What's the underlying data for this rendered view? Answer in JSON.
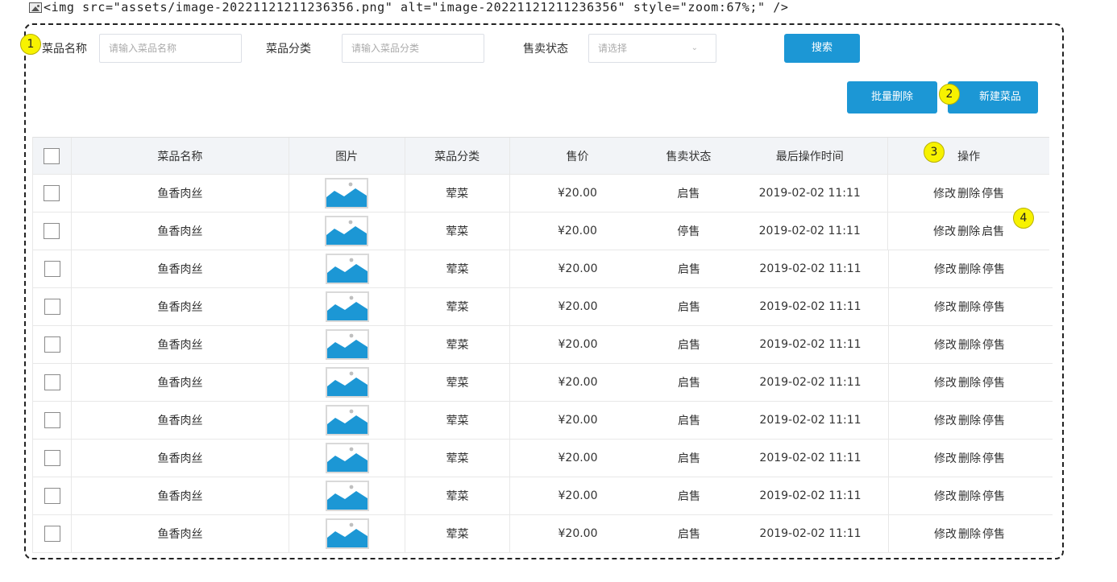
{
  "top_line": {
    "text": "<img src=\"assets/image-20221121211236356.png\" alt=\"image-20221121211236356\" style=\"zoom:67%;\" />"
  },
  "filters": {
    "name_label": "菜品名称",
    "name_placeholder": "请输入菜品名称",
    "category_label": "菜品分类",
    "category_placeholder": "请输入菜品分类",
    "status_label": "售卖状态",
    "status_placeholder": "请选择",
    "search_button": "搜索"
  },
  "actions": {
    "batch_delete": "批量删除",
    "new_dish": "新建菜品"
  },
  "markers": [
    "1",
    "2",
    "3",
    "4"
  ],
  "table": {
    "headers": {
      "name": "菜品名称",
      "image": "图片",
      "category": "菜品分类",
      "price": "售价",
      "status": "售卖状态",
      "time": "最后操作时间",
      "ops": "操作"
    },
    "rows": [
      {
        "name": "鱼香肉丝",
        "category": "荤菜",
        "price": "¥20.00",
        "status": "启售",
        "time": "2019-02-02 11:11",
        "op_edit": "修改",
        "op_delete": "删除",
        "op_toggle": "停售"
      },
      {
        "name": "鱼香肉丝",
        "category": "荤菜",
        "price": "¥20.00",
        "status": "停售",
        "time": "2019-02-02 11:11",
        "op_edit": "修改",
        "op_delete": "删除",
        "op_toggle": "启售"
      },
      {
        "name": "鱼香肉丝",
        "category": "荤菜",
        "price": "¥20.00",
        "status": "启售",
        "time": "2019-02-02 11:11",
        "op_edit": "修改",
        "op_delete": "删除",
        "op_toggle": "停售"
      },
      {
        "name": "鱼香肉丝",
        "category": "荤菜",
        "price": "¥20.00",
        "status": "启售",
        "time": "2019-02-02 11:11",
        "op_edit": "修改",
        "op_delete": "删除",
        "op_toggle": "停售"
      },
      {
        "name": "鱼香肉丝",
        "category": "荤菜",
        "price": "¥20.00",
        "status": "启售",
        "time": "2019-02-02 11:11",
        "op_edit": "修改",
        "op_delete": "删除",
        "op_toggle": "停售"
      },
      {
        "name": "鱼香肉丝",
        "category": "荤菜",
        "price": "¥20.00",
        "status": "启售",
        "time": "2019-02-02 11:11",
        "op_edit": "修改",
        "op_delete": "删除",
        "op_toggle": "停售"
      },
      {
        "name": "鱼香肉丝",
        "category": "荤菜",
        "price": "¥20.00",
        "status": "启售",
        "time": "2019-02-02 11:11",
        "op_edit": "修改",
        "op_delete": "删除",
        "op_toggle": "停售"
      },
      {
        "name": "鱼香肉丝",
        "category": "荤菜",
        "price": "¥20.00",
        "status": "启售",
        "time": "2019-02-02 11:11",
        "op_edit": "修改",
        "op_delete": "删除",
        "op_toggle": "停售"
      },
      {
        "name": "鱼香肉丝",
        "category": "荤菜",
        "price": "¥20.00",
        "status": "启售",
        "time": "2019-02-02 11:11",
        "op_edit": "修改",
        "op_delete": "删除",
        "op_toggle": "停售"
      },
      {
        "name": "鱼香肉丝",
        "category": "荤菜",
        "price": "¥20.00",
        "status": "启售",
        "time": "2019-02-02 11:11",
        "op_edit": "修改",
        "op_delete": "删除",
        "op_toggle": "停售"
      }
    ]
  },
  "colors": {
    "primary": "#1c97d5",
    "marker": "#f7f200",
    "header_bg": "#f2f4f7"
  },
  "icons": {
    "broken_image": "broken-image-icon",
    "thumbnail": "image-placeholder-icon",
    "select_arrow": "chevron-down-icon"
  }
}
